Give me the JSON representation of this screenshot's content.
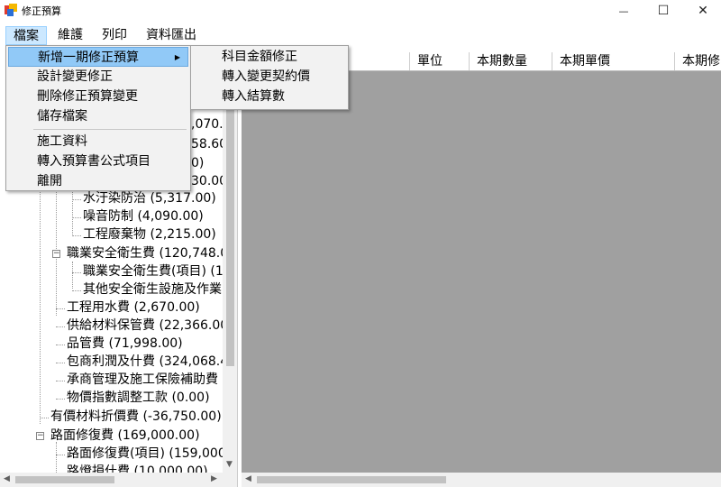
{
  "window": {
    "title": "修正預算",
    "minimize_glyph": "—",
    "maximize_glyph": "☐",
    "close_glyph": "✕"
  },
  "menubar": {
    "items": [
      "檔案",
      "維護",
      "列印",
      "資料匯出"
    ]
  },
  "file_menu": {
    "items": [
      {
        "label": "新增一期修正預算",
        "highlighted": true,
        "has_submenu": true
      },
      {
        "label": "設計變更修正"
      },
      {
        "label": "刪除修正預算變更"
      },
      {
        "label": "儲存檔案"
      },
      {
        "label": "施工資料"
      },
      {
        "label": "轉入預算書公式項目"
      },
      {
        "label": "離開"
      }
    ]
  },
  "submenu": {
    "items": [
      "科目金額修正",
      "轉入變更契約價",
      "轉入結算數"
    ]
  },
  "grid": {
    "columns": [
      "單位",
      "本期數量",
      "本期單價",
      "本期修"
    ]
  },
  "tree": {
    "partial_fragments": [
      ",070.(",
      "58.60",
      "0)",
      "30.00)"
    ],
    "nodes": [
      {
        "label": "水汙染防治 (5,317.00)"
      },
      {
        "label": "噪音防制 (4,090.00)"
      },
      {
        "label": "工程廢棄物 (2,215.00)"
      },
      {
        "label": "職業安全衛生費 (120,748.0"
      },
      {
        "label": "職業安全衛生費(項目) (1"
      },
      {
        "label": "其他安全衛生設施及作業"
      },
      {
        "label": "工程用水費 (2,670.00)"
      },
      {
        "label": "供給材料保管費 (22,366.00"
      },
      {
        "label": "品管費 (71,998.00)"
      },
      {
        "label": "包商利潤及什費 (324,068.4"
      },
      {
        "label": "承商管理及施工保險補助費"
      },
      {
        "label": "物價指數調整工款 (0.00)"
      },
      {
        "label": "有價材料折價費 (-36,750.00)"
      },
      {
        "label": "路面修復費 (169,000.00)"
      },
      {
        "label": "路面修復費(項目) (159,000"
      },
      {
        "label": "路燈損什費 (10,000.00)"
      }
    ]
  },
  "icons": {
    "expander_minus": "−",
    "submenu_arrow": "▶",
    "scroll_up": "▲",
    "scroll_down": "▼",
    "scroll_left": "◀",
    "scroll_right": "▶"
  }
}
